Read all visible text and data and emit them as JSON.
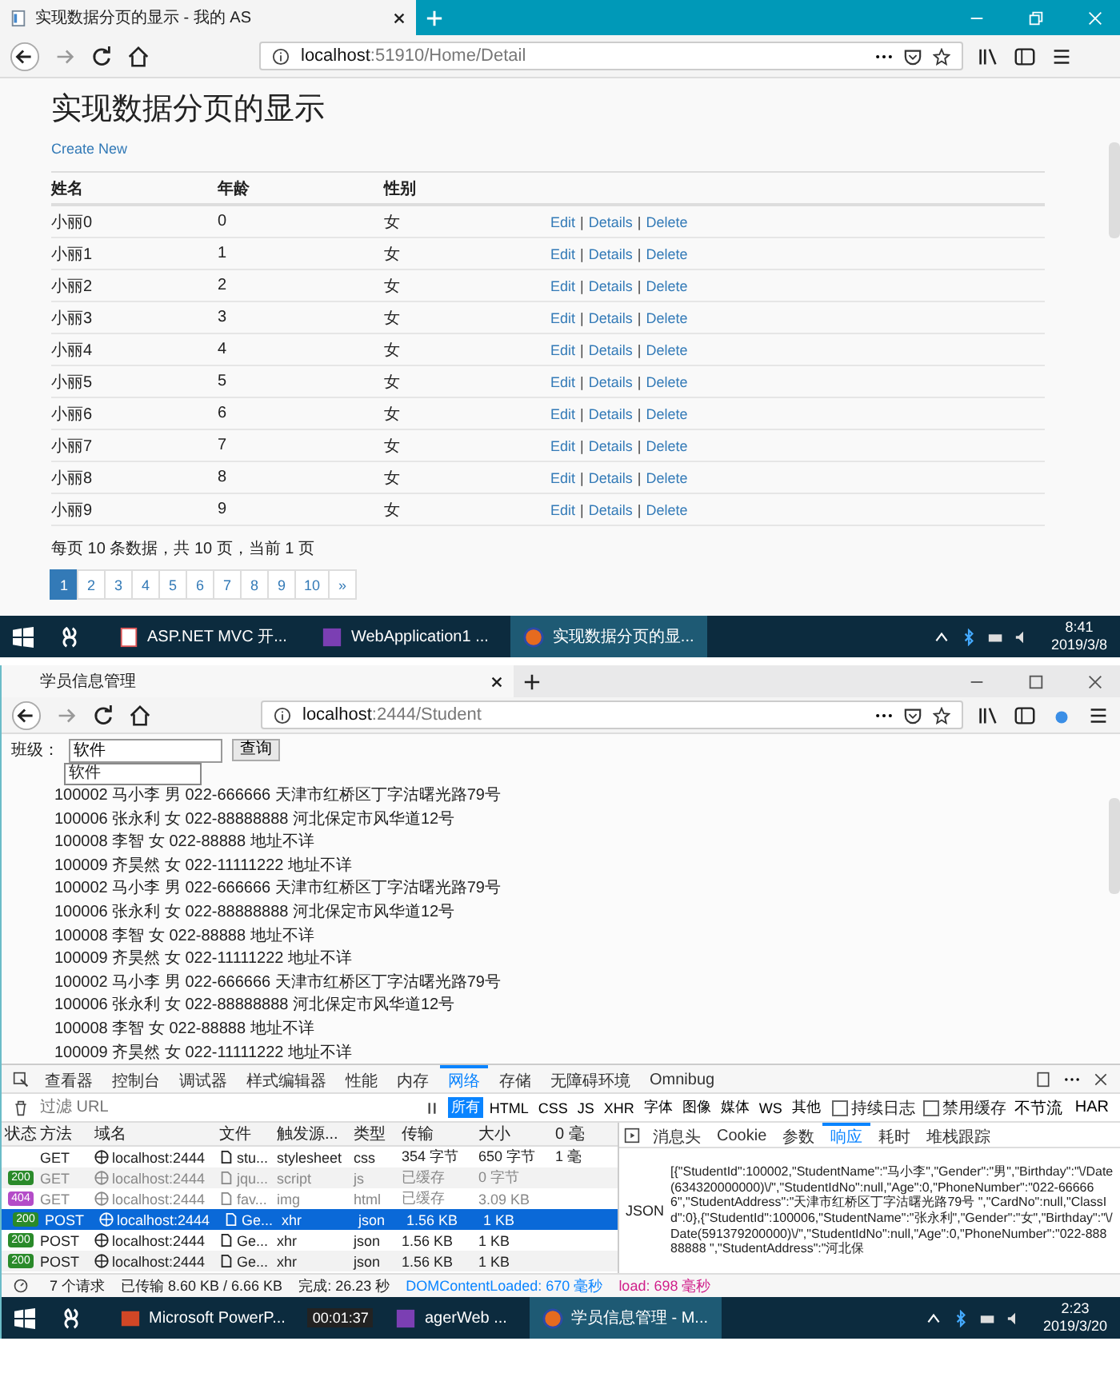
{
  "top_window": {
    "tab_title": "实现数据分页的显示 - 我的 AS",
    "url": "**localhost**:51910/Home/Detail",
    "page": {
      "heading": "实现数据分页的显示",
      "create_link": "Create New",
      "table": {
        "columns": [
          "姓名",
          "年龄",
          "性别"
        ],
        "rows": [
          {
            "name": "小丽0",
            "age": "0",
            "gender": "女",
            "actions": [
              {
                "kind": "link",
                "text": "Edit"
              },
              {
                "kind": "separator",
                "text": "|"
              },
              {
                "kind": "link",
                "text": "Details"
              },
              {
                "kind": "separator",
                "text": "|"
              },
              {
                "kind": "link",
                "text": "Delete"
              }
            ]
          },
          {
            "name": "小丽1",
            "age": "1",
            "gender": "女",
            "actions": [
              {
                "kind": "link",
                "text": "Edit"
              },
              {
                "kind": "separator",
                "text": "|"
              },
              {
                "kind": "link",
                "text": "Details"
              },
              {
                "kind": "separator",
                "text": "|"
              },
              {
                "kind": "link",
                "text": "Delete"
              }
            ]
          },
          {
            "name": "小丽2",
            "age": "2",
            "gender": "女",
            "actions": [
              {
                "kind": "link",
                "text": "Edit"
              },
              {
                "kind": "separator",
                "text": "|"
              },
              {
                "kind": "link",
                "text": "Details"
              },
              {
                "kind": "separator",
                "text": "|"
              },
              {
                "kind": "link",
                "text": "Delete"
              }
            ]
          },
          {
            "name": "小丽3",
            "age": "3",
            "gender": "女",
            "actions": [
              {
                "kind": "link",
                "text": "Edit"
              },
              {
                "kind": "separator",
                "text": "|"
              },
              {
                "kind": "link",
                "text": "Details"
              },
              {
                "kind": "separator",
                "text": "|"
              },
              {
                "kind": "link",
                "text": "Delete"
              }
            ]
          },
          {
            "name": "小丽4",
            "age": "4",
            "gender": "女",
            "actions": [
              {
                "kind": "link",
                "text": "Edit"
              },
              {
                "kind": "separator",
                "text": "|"
              },
              {
                "kind": "link",
                "text": "Details"
              },
              {
                "kind": "separator",
                "text": "|"
              },
              {
                "kind": "link",
                "text": "Delete"
              }
            ]
          },
          {
            "name": "小丽5",
            "age": "5",
            "gender": "女",
            "actions": [
              {
                "kind": "link",
                "text": "Edit"
              },
              {
                "kind": "separator",
                "text": "|"
              },
              {
                "kind": "link",
                "text": "Details"
              },
              {
                "kind": "separator",
                "text": "|"
              },
              {
                "kind": "link",
                "text": "Delete"
              }
            ]
          },
          {
            "name": "小丽6",
            "age": "6",
            "gender": "女",
            "actions": [
              {
                "kind": "link",
                "text": "Edit"
              },
              {
                "kind": "separator",
                "text": "|"
              },
              {
                "kind": "link",
                "text": "Details"
              },
              {
                "kind": "separator",
                "text": "|"
              },
              {
                "kind": "link",
                "text": "Delete"
              }
            ]
          },
          {
            "name": "小丽7",
            "age": "7",
            "gender": "女",
            "actions": [
              {
                "kind": "link",
                "text": "Edit"
              },
              {
                "kind": "separator",
                "text": "|"
              },
              {
                "kind": "link",
                "text": "Details"
              },
              {
                "kind": "separator",
                "text": "|"
              },
              {
                "kind": "link",
                "text": "Delete"
              }
            ]
          },
          {
            "name": "小丽8",
            "age": "8",
            "gender": "女",
            "actions": [
              {
                "kind": "link",
                "text": "Edit"
              },
              {
                "kind": "separator",
                "text": "|"
              },
              {
                "kind": "link",
                "text": "Details"
              },
              {
                "kind": "separator",
                "text": "|"
              },
              {
                "kind": "link",
                "text": "Delete"
              }
            ]
          },
          {
            "name": "小丽9",
            "age": "9",
            "gender": "女",
            "actions": [
              {
                "kind": "link",
                "text": "Edit"
              },
              {
                "kind": "separator",
                "text": "|"
              },
              {
                "kind": "link",
                "text": "Details"
              },
              {
                "kind": "separator",
                "text": "|"
              },
              {
                "kind": "link",
                "text": "Delete"
              }
            ]
          }
        ]
      },
      "summary": "每页 10 条数据，共 10 页，当前 1 页",
      "pagination": [
        {
          "label": "1",
          "selected": true
        },
        {
          "label": "2",
          "selected": false
        },
        {
          "label": "3",
          "selected": false
        },
        {
          "label": "4",
          "selected": false
        },
        {
          "label": "5",
          "selected": false
        },
        {
          "label": "6",
          "selected": false
        },
        {
          "label": "7",
          "selected": false
        },
        {
          "label": "8",
          "selected": false
        },
        {
          "label": "9",
          "selected": false
        },
        {
          "label": "10",
          "selected": false
        },
        {
          "label": "»",
          "selected": false
        }
      ]
    },
    "taskbar": {
      "items": [
        {
          "label": "ASP.NET MVC 开...",
          "kind": "document",
          "selected": false
        },
        {
          "label": "WebApplication1 ...",
          "kind": "studio",
          "selected": false
        },
        {
          "label": "实现数据分页的显...",
          "kind": "browser",
          "selected": true
        }
      ],
      "time": "8:41",
      "date": "2019/3/8"
    }
  },
  "bottom_window": {
    "tab_title": "学员信息管理",
    "url": "**localhost**:2444/Student",
    "page": {
      "class_label": "班级：",
      "class_value": "软件",
      "query_button": "查询",
      "suggestion": "软件",
      "rows": [
        "100002 马小李 男 022-666666 天津市红桥区丁字沽曙光路79号",
        "100006 张永利 女 022-88888888  河北保定市风华道12号",
        "100008 李智 女 022-88888 地址不详",
        "100009 齐昊然 女 022-11111222 地址不详",
        "100002 马小李 男 022-666666 天津市红桥区丁字沽曙光路79号",
        "100006 张永利 女 022-88888888  河北保定市风华道12号",
        "100008 李智 女 022-88888 地址不详",
        "100009 齐昊然 女 022-11111222 地址不详",
        "100002 马小李 男 022-666666 天津市红桥区丁字沽曙光路79号",
        "100006 张永利 女 022-88888888  河北保定市风华道12号",
        "100008 李智 女 022-88888 地址不详",
        "100009 齐昊然 女 022-11111222 地址不详"
      ]
    },
    "devtools": {
      "tabs": [
        {
          "label": "查看器",
          "selected": false
        },
        {
          "label": "控制台",
          "selected": false
        },
        {
          "label": "调试器",
          "selected": false
        },
        {
          "label": "样式编辑器",
          "selected": false
        },
        {
          "label": "性能",
          "selected": false
        },
        {
          "label": "内存",
          "selected": false
        },
        {
          "label": "网络",
          "selected": true
        },
        {
          "label": "存储",
          "selected": false
        },
        {
          "label": "无障碍环境",
          "selected": false
        },
        {
          "label": "Omnibug",
          "selected": false
        }
      ],
      "filter_placeholder": "过滤 URL",
      "type_filters": [
        {
          "label": "所有",
          "selected": true
        },
        {
          "label": "HTML",
          "selected": false
        },
        {
          "label": "CSS",
          "selected": false
        },
        {
          "label": "JS",
          "selected": false
        },
        {
          "label": "XHR",
          "selected": false
        },
        {
          "label": "字体",
          "selected": false
        },
        {
          "label": "图像",
          "selected": false
        },
        {
          "label": "媒体",
          "selected": false
        },
        {
          "label": "WS",
          "selected": false
        },
        {
          "label": "其他",
          "selected": false
        }
      ],
      "options": [
        {
          "label": "持续日志",
          "checked": false
        },
        {
          "label": "禁用缓存",
          "checked": false
        }
      ],
      "throttle": "不节流",
      "har": "HAR",
      "columns": [
        "状态",
        "方法",
        "域名",
        "文件",
        "触发源...",
        "类型",
        "传输",
        "大小",
        "0 毫"
      ],
      "requests": [
        {
          "method": "GET",
          "domain": "localhost:2444",
          "file": "stu...",
          "cause": "stylesheet",
          "type": "css",
          "transferred": "354 字节",
          "size": "650 字节",
          "timing": "1 毫",
          "cached": false,
          "selected": false
        },
        {
          "status": "200",
          "color": "#2a8a2a",
          "method": "GET",
          "domain": "localhost:2444",
          "file": "jqu...",
          "cause": "script",
          "type": "js",
          "transferred": "已缓存",
          "size": "0 字节",
          "cached": true,
          "selected": false
        },
        {
          "status": "404",
          "color": "#b44cc8",
          "method": "GET",
          "domain": "localhost:2444",
          "file": "fav...",
          "cause": "img",
          "type": "html",
          "transferred": "已缓存",
          "size": "3.09 KB",
          "cached": true,
          "selected": false
        },
        {
          "status": "200",
          "color": "#2a8a2a",
          "method": "POST",
          "domain": "localhost:2444",
          "file": "Ge...",
          "cause": "xhr",
          "type": "json",
          "transferred": "1.56 KB",
          "size": "1 KB",
          "cached": false,
          "selected": true
        },
        {
          "status": "200",
          "color": "#2a8a2a",
          "method": "POST",
          "domain": "localhost:2444",
          "file": "Ge...",
          "cause": "xhr",
          "type": "json",
          "transferred": "1.56 KB",
          "size": "1 KB",
          "cached": false,
          "selected": false
        },
        {
          "status": "200",
          "color": "#2a8a2a",
          "method": "POST",
          "domain": "localhost:2444",
          "file": "Ge...",
          "cause": "xhr",
          "type": "json",
          "transferred": "1.56 KB",
          "size": "1 KB",
          "cached": false,
          "selected": false
        }
      ],
      "detail_tabs": [
        {
          "label": "消息头",
          "selected": false
        },
        {
          "label": "Cookie",
          "selected": false
        },
        {
          "label": "参数",
          "selected": false
        },
        {
          "label": "响应",
          "selected": true
        },
        {
          "label": "耗时",
          "selected": false
        },
        {
          "label": "堆栈跟踪",
          "selected": false
        }
      ],
      "response_label": "JSON",
      "response_text": "[{\"StudentId\":100002,\"StudentName\":\"马小李\",\"Gender\":\"男\",\"Birthday\":\"\\/Date(634320000000)\\/\",\"StudentIdNo\":null,\"Age\":0,\"PhoneNumber\":\"022-666666\",\"StudentAddress\":\"天津市红桥区丁字沽曙光路79号 \",\"CardNo\":null,\"ClassId\":0},{\"StudentId\":100006,\"StudentName\":\"张永利\",\"Gender\":\"女\",\"Birthday\":\"\\/Date(591379200000)\\/\",\"StudentIdNo\":null,\"Age\":0,\"PhoneNumber\":\"022-88888888 \",\"StudentAddress\":\"河北保",
      "status": {
        "requests": "7 个请求",
        "transferred": "已传输 8.60 KB / 6.66 KB",
        "finish": "完成: 26.23 秒",
        "dom": "DOMContentLoaded: 670 毫秒",
        "load": "load: 698 毫秒"
      }
    },
    "taskbar": {
      "items": [
        {
          "label": "Microsoft PowerP...",
          "kind": "slides",
          "selected": false
        },
        {
          "label": "agerWeb ...",
          "kind": "studio",
          "selected": false
        },
        {
          "label": "学员信息管理 - M...",
          "kind": "browser",
          "selected": true
        }
      ],
      "timer": "00:01:37",
      "time": "2:23",
      "date": "2019/3/20"
    }
  }
}
